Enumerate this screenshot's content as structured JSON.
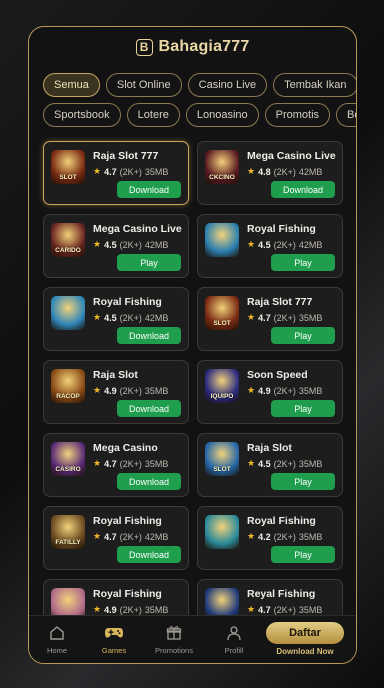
{
  "header": {
    "logo_letter": "B",
    "brand": "Bahagia777"
  },
  "filters": {
    "row1": [
      {
        "label": "Semua",
        "active": true
      },
      {
        "label": "Slot Online"
      },
      {
        "label": "Casino Live"
      },
      {
        "label": "Tembak Ikan"
      },
      {
        "label": ""
      }
    ],
    "row2": [
      {
        "label": "Sportsbook"
      },
      {
        "label": "Lotere"
      },
      {
        "label": "Lonoasino"
      },
      {
        "label": "Promotis"
      },
      {
        "label": "Boi"
      }
    ]
  },
  "games": [
    {
      "title": "Raja Slot 777",
      "rating": "4.7",
      "count": "(2K+)",
      "size": "35MB",
      "button": "Download",
      "featured": true,
      "thumb_tag": "SLOT",
      "thumb_color": "#7a2a12",
      "icon": "slot-777-icon"
    },
    {
      "title": "Mega Casino Live",
      "rating": "4.8",
      "count": "(2K+)",
      "size": "42MB",
      "button": "Download",
      "thumb_tag": "CKCINO",
      "thumb_color": "#5a1a22",
      "icon": "casino-dealer-icon"
    },
    {
      "title": "Mega Casino Live",
      "rating": "4.5",
      "count": "(2K+)",
      "size": "42MB",
      "button": "Play",
      "thumb_tag": "CARIDO",
      "thumb_color": "#6a2420",
      "icon": "casino-dealer-icon"
    },
    {
      "title": "Royal Fishing",
      "rating": "4.5",
      "count": "(2K+)",
      "size": "42MB",
      "button": "Play",
      "thumb_tag": "",
      "thumb_color": "#2b7fb0",
      "icon": "fishing-icon"
    },
    {
      "title": "Royal Fishing",
      "rating": "4.5",
      "count": "(2K+)",
      "size": "42MB",
      "button": "Download",
      "thumb_tag": "",
      "thumb_color": "#2f86b8",
      "icon": "fishing-icon"
    },
    {
      "title": "Raja Slot 777",
      "rating": "4.7",
      "count": "(2K+)",
      "size": "35MB",
      "button": "Play",
      "thumb_tag": "SLOT",
      "thumb_color": "#7a2a12",
      "icon": "slot-777-icon"
    },
    {
      "title": "Raja Slot",
      "rating": "4.9",
      "count": "(2K+)",
      "size": "35MB",
      "button": "Download",
      "thumb_tag": "RACOP",
      "thumb_color": "#8a4a16",
      "icon": "slot-monkey-icon"
    },
    {
      "title": "Soon Speed",
      "rating": "4.9",
      "count": "(2K+)",
      "size": "35MB",
      "button": "Play",
      "thumb_tag": "IQUIPO",
      "thumb_color": "#2a2a80",
      "icon": "panda-icon"
    },
    {
      "title": "Mega Casino",
      "rating": "4.7",
      "count": "(2K+)",
      "size": "35MB",
      "button": "Download",
      "thumb_tag": "CASIRO",
      "thumb_color": "#5a2a78",
      "icon": "casino-monkey-icon"
    },
    {
      "title": "Raja Slot",
      "rating": "4.5",
      "count": "(2K+)",
      "size": "35MB",
      "button": "Play",
      "thumb_tag": "SLOT",
      "thumb_color": "#2466a8",
      "icon": "slot-dragon-icon"
    },
    {
      "title": "Royal Fishing",
      "rating": "4.7",
      "count": "(2K+)",
      "size": "42MB",
      "button": "Download",
      "thumb_tag": "FATILLY",
      "thumb_color": "#6a4a20",
      "icon": "fishing-temple-icon"
    },
    {
      "title": "Royal Fishing",
      "rating": "4.2",
      "count": "(2K+)",
      "size": "35MB",
      "button": "Play",
      "thumb_tag": "",
      "thumb_color": "#2b8a9a",
      "icon": "fishing-icon"
    },
    {
      "title": "Royal Fishing",
      "rating": "4.9",
      "count": "(2K+)",
      "size": "35MB",
      "button": "",
      "thumb_tag": "",
      "thumb_color": "#b06a8a",
      "icon": "fishing-princess-icon"
    },
    {
      "title": "Reyal Fishing",
      "rating": "4.7",
      "count": "(2K+)",
      "size": "35MB",
      "button": "",
      "thumb_tag": "",
      "thumb_color": "#1e3a7a",
      "icon": "fishing-dragon-icon"
    }
  ],
  "tabbar": {
    "tabs": [
      {
        "label": "Home",
        "icon": "home-icon"
      },
      {
        "label": "Games",
        "icon": "gamepad-icon",
        "active": true
      },
      {
        "label": "Promotions",
        "icon": "gift-icon"
      },
      {
        "label": "Profill",
        "icon": "user-icon"
      }
    ],
    "cta_label": "Daftar",
    "cta_sub": "Download Now"
  },
  "colors": {
    "accent_gold": "#c9a85c",
    "button_green": "#1f9e4d",
    "star": "#f0b92b"
  }
}
